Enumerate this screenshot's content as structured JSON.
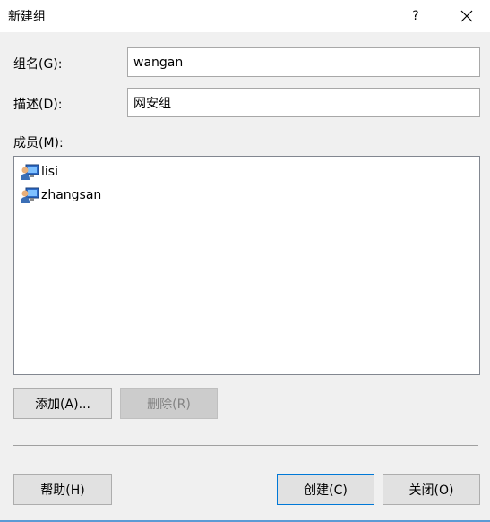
{
  "window": {
    "title": "新建组",
    "help_label": "?",
    "close_icon": "close-icon"
  },
  "form": {
    "group_name_label": "组名(G):",
    "group_name_value": "wangan",
    "description_label": "描述(D):",
    "description_value": "网安组",
    "members_label": "成员(M):"
  },
  "members": [
    {
      "name": "lisi",
      "icon": "user-icon"
    },
    {
      "name": "zhangsan",
      "icon": "user-icon"
    }
  ],
  "buttons": {
    "add": "添加(A)...",
    "remove": "删除(R)",
    "help": "帮助(H)",
    "create": "创建(C)",
    "close": "关闭(O)"
  },
  "colors": {
    "dialog_background": "#f0f0f0",
    "accent": "#0078d7"
  }
}
